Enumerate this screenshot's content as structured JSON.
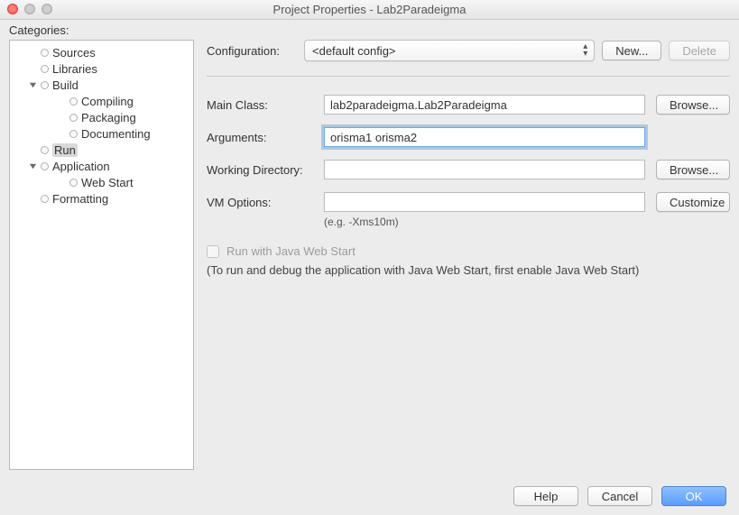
{
  "window": {
    "title": "Project Properties - Lab2Paradeigma",
    "categories_label": "Categories:"
  },
  "tree": {
    "items": [
      {
        "label": "Sources",
        "level": 1,
        "twisty": "none"
      },
      {
        "label": "Libraries",
        "level": 1,
        "twisty": "none"
      },
      {
        "label": "Build",
        "level": 1,
        "twisty": "down"
      },
      {
        "label": "Compiling",
        "level": 2,
        "twisty": "none"
      },
      {
        "label": "Packaging",
        "level": 2,
        "twisty": "none"
      },
      {
        "label": "Documenting",
        "level": 2,
        "twisty": "none"
      },
      {
        "label": "Run",
        "level": 1,
        "twisty": "none",
        "selected": true
      },
      {
        "label": "Application",
        "level": 1,
        "twisty": "down"
      },
      {
        "label": "Web Start",
        "level": 2,
        "twisty": "none"
      },
      {
        "label": "Formatting",
        "level": 1,
        "twisty": "none"
      }
    ]
  },
  "config": {
    "label": "Configuration:",
    "selected": "<default config>",
    "new_label": "New...",
    "delete_label": "Delete"
  },
  "form": {
    "main_class_label": "Main Class:",
    "main_class_value": "lab2paradeigma.Lab2Paradeigma",
    "arguments_label": "Arguments:",
    "arguments_value": "orisma1 orisma2",
    "workdir_label": "Working Directory:",
    "workdir_value": "",
    "vmoptions_label": "VM Options:",
    "vmoptions_value": "",
    "vm_hint": "(e.g. -Xms10m)",
    "browse_label": "Browse...",
    "customize_label": "Customize"
  },
  "webstart": {
    "checkbox_label": "Run with Java Web Start",
    "note": "(To run and debug the application with Java Web Start, first enable Java Web Start)"
  },
  "footer": {
    "help": "Help",
    "cancel": "Cancel",
    "ok": "OK"
  }
}
